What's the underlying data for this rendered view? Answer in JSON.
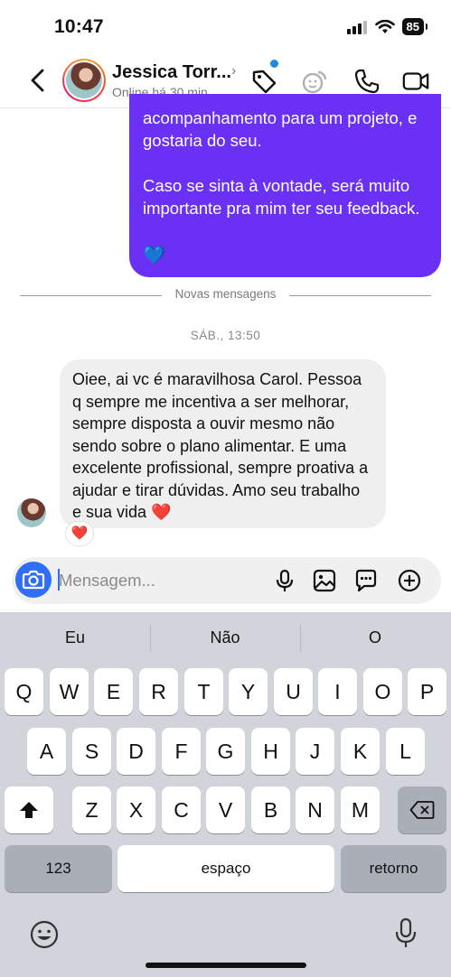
{
  "status": {
    "time": "10:47",
    "battery": "85"
  },
  "header": {
    "name": "Jessica Torr...",
    "status": "Online há 30 min"
  },
  "messages": {
    "sent_paragraph_1": "acompanhamento para um projeto, e gostaria do seu.",
    "sent_paragraph_2": "Caso se sinta à vontade, será muito importante pra mim ter seu feedback.",
    "sent_emoji": "💙",
    "divider_label": "Novas mensagens",
    "timestamp": "SÁB., 13:50",
    "received_text": "Oiee, ai vc é maravilhosa Carol. Pessoa q sempre me incentiva a ser melhorar, sempre disposta a ouvir mesmo não sendo sobre o plano alimentar. E uma excelente profissional, sempre proativa a ajudar e tirar dúvidas. Amo seu trabalho e sua vida ❤️",
    "reaction": "❤️"
  },
  "composer": {
    "placeholder": "Mensagem..."
  },
  "keyboard": {
    "suggestions": [
      "Eu",
      "Não",
      "O"
    ],
    "row1": [
      "Q",
      "W",
      "E",
      "R",
      "T",
      "Y",
      "U",
      "I",
      "O",
      "P"
    ],
    "row2": [
      "A",
      "S",
      "D",
      "F",
      "G",
      "H",
      "J",
      "K",
      "L"
    ],
    "row3": [
      "Z",
      "X",
      "C",
      "V",
      "B",
      "N",
      "M"
    ],
    "numbers_label": "123",
    "space_label": "espaço",
    "return_label": "retorno"
  },
  "colors": {
    "sent_bubble": "#6a31f5",
    "accent_blue": "#2f6ff5",
    "received_bubble": "#efefef"
  }
}
